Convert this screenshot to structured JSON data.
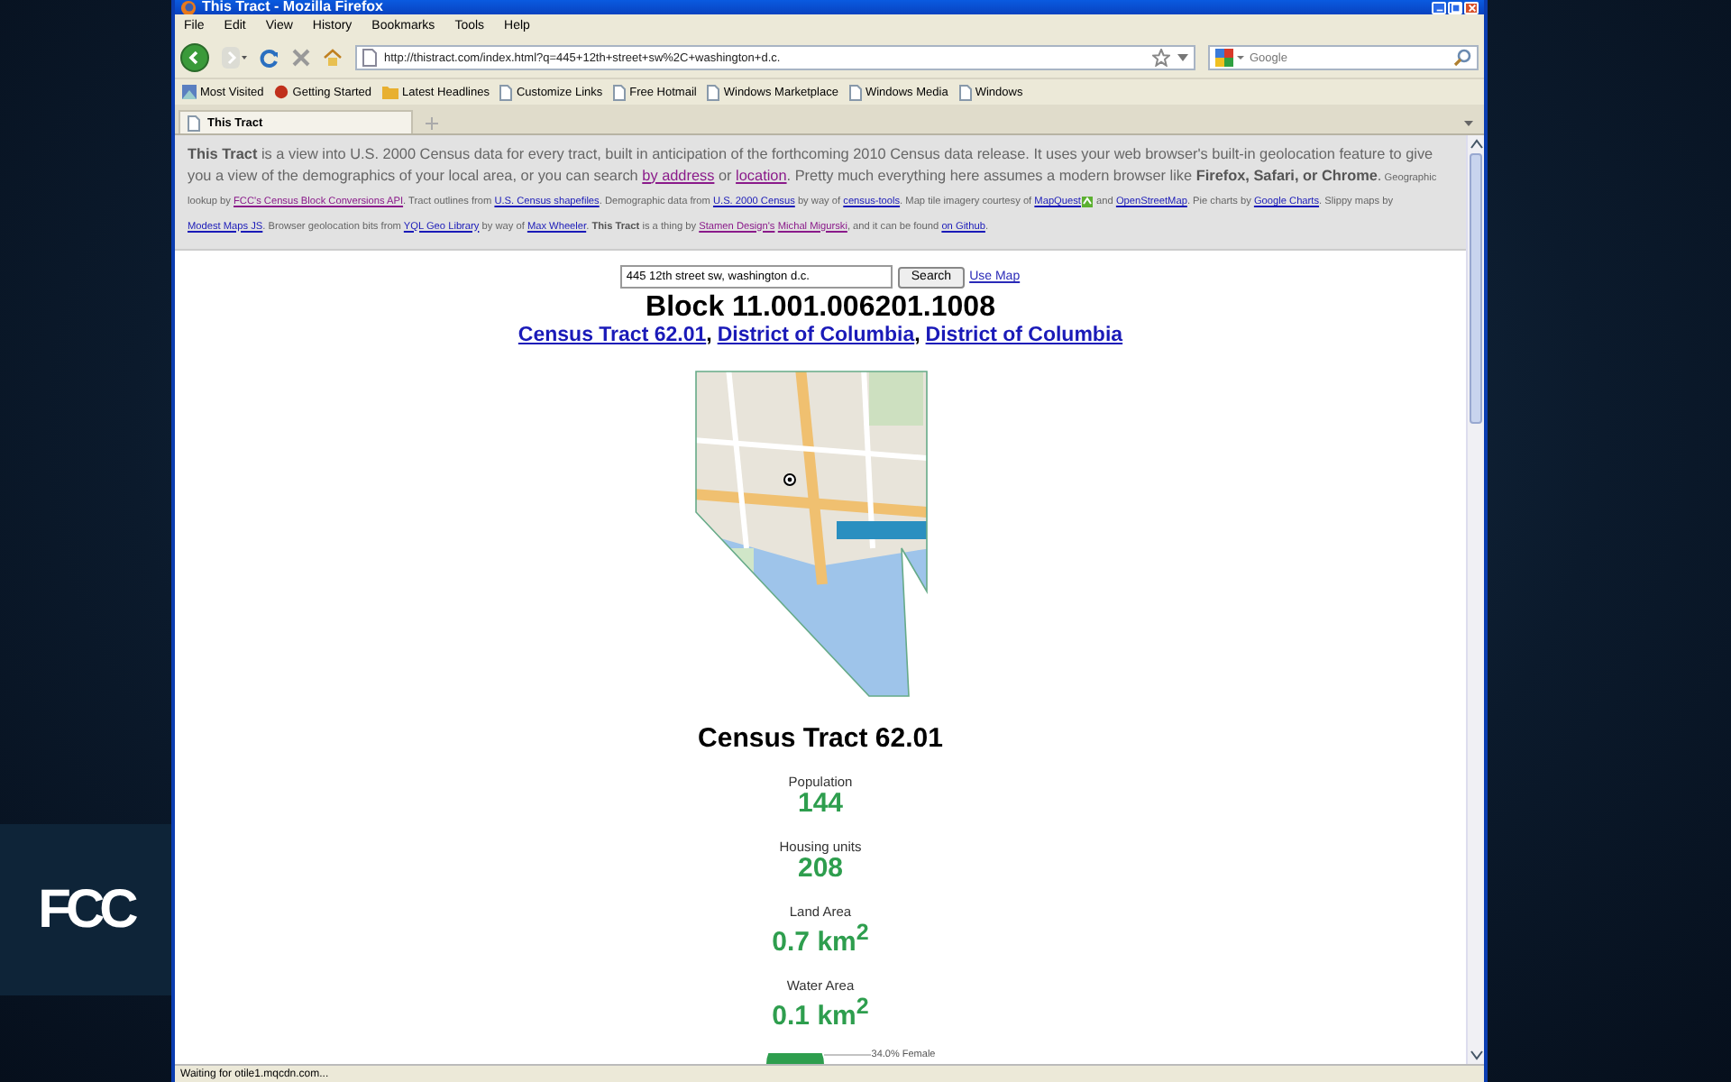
{
  "logo": {
    "text": "FCC"
  },
  "window": {
    "title": "This Tract - Mozilla Firefox"
  },
  "menu": [
    "File",
    "Edit",
    "View",
    "History",
    "Bookmarks",
    "Tools",
    "Help"
  ],
  "toolbar": {
    "url": "http://thistract.com/index.html?q=445+12th+street+sw%2C+washington+d.c.",
    "search_placeholder": "Google"
  },
  "bookmarks": [
    {
      "label": "Most Visited",
      "kind": "smart"
    },
    {
      "label": "Getting Started",
      "kind": "firefox"
    },
    {
      "label": "Latest Headlines",
      "kind": "feed"
    },
    {
      "label": "Customize Links",
      "kind": "page"
    },
    {
      "label": "Free Hotmail",
      "kind": "page"
    },
    {
      "label": "Windows Marketplace",
      "kind": "page"
    },
    {
      "label": "Windows Media",
      "kind": "page"
    },
    {
      "label": "Windows",
      "kind": "page"
    }
  ],
  "tabs": [
    {
      "label": "This Tract",
      "selected": true
    }
  ],
  "intro": {
    "main": [
      {
        "kind": "bold",
        "text": "This Tract"
      },
      {
        "kind": "text",
        "text": " is a view into U.S. 2000 Census data for every tract, built in anticipation of the forthcoming 2010 Census data release. It uses your web browser's built-in geolocation feature to give you a view of the demographics of your local area, or you can search "
      },
      {
        "kind": "link",
        "text": "by address",
        "visited": true
      },
      {
        "kind": "text",
        "text": " or "
      },
      {
        "kind": "link",
        "text": "location",
        "visited": true
      },
      {
        "kind": "text",
        "text": ". Pretty much everything here assumes a modern browser like "
      },
      {
        "kind": "bold",
        "text": "Firefox, Safari, or Chrome"
      },
      {
        "kind": "text",
        "text": "."
      }
    ],
    "credits": [
      {
        "kind": "text",
        "text": " Geographic lookup by "
      },
      {
        "kind": "link",
        "text": "FCC's Census Block Conversions API",
        "visited": true
      },
      {
        "kind": "text",
        "text": ". Tract outlines from "
      },
      {
        "kind": "link",
        "text": "U.S. Census shapefiles",
        "visited": false
      },
      {
        "kind": "text",
        "text": ". Demographic data from "
      },
      {
        "kind": "link",
        "text": "U.S. 2000 Census",
        "visited": false
      },
      {
        "kind": "text",
        "text": " by way of "
      },
      {
        "kind": "link",
        "text": "census-tools",
        "visited": false
      },
      {
        "kind": "text",
        "text": ". Map tile imagery courtesy of "
      },
      {
        "kind": "link",
        "text": "MapQuest",
        "visited": false
      },
      {
        "kind": "icon"
      },
      {
        "kind": "text",
        "text": " and "
      },
      {
        "kind": "link",
        "text": "OpenStreetMap",
        "visited": false
      },
      {
        "kind": "text",
        "text": ". Pie charts by "
      },
      {
        "kind": "link",
        "text": "Google Charts",
        "visited": false
      },
      {
        "kind": "text",
        "text": ". Slippy maps by "
      },
      {
        "kind": "link",
        "text": "Modest Maps JS",
        "visited": false
      },
      {
        "kind": "text",
        "text": ". Browser geolocation bits from "
      },
      {
        "kind": "link",
        "text": "YQL Geo Library",
        "visited": false
      },
      {
        "kind": "text",
        "text": " by way of "
      },
      {
        "kind": "link",
        "text": "Max Wheeler",
        "visited": false
      },
      {
        "kind": "text",
        "text": ". "
      },
      {
        "kind": "bold",
        "text": "This Tract"
      },
      {
        "kind": "text",
        "text": " is a thing by "
      },
      {
        "kind": "link",
        "text": "Stamen Design's",
        "visited": true
      },
      {
        "kind": "link",
        "text": "Michal Migurski",
        "visited": true
      },
      {
        "kind": "text",
        "text": ", and it can be found "
      },
      {
        "kind": "link",
        "text": "on Github",
        "visited": false
      },
      {
        "kind": "text",
        "text": "."
      }
    ]
  },
  "search": {
    "value": "445 12th street sw, washington d.c.",
    "button": "Search",
    "map_link": "Use Map"
  },
  "block": {
    "title": "Block 11.001.006201.1008",
    "links": [
      "Census Tract 62.01",
      "District of Columbia",
      "District of Columbia"
    ],
    "separator": ","
  },
  "tract": {
    "title": "Census Tract 62.01",
    "stats": [
      {
        "label": "Population",
        "value": "144"
      },
      {
        "label": "Housing units",
        "value": "208"
      },
      {
        "label": "Land Area",
        "value": "0.7 km$^{2}$"
      },
      {
        "label": "Water Area",
        "value": "0.1 km$^{2}$"
      }
    ],
    "pie_label": "34.0% Female"
  },
  "status_bar": {
    "text": "Waiting for otile1.mqcdn.com..."
  }
}
